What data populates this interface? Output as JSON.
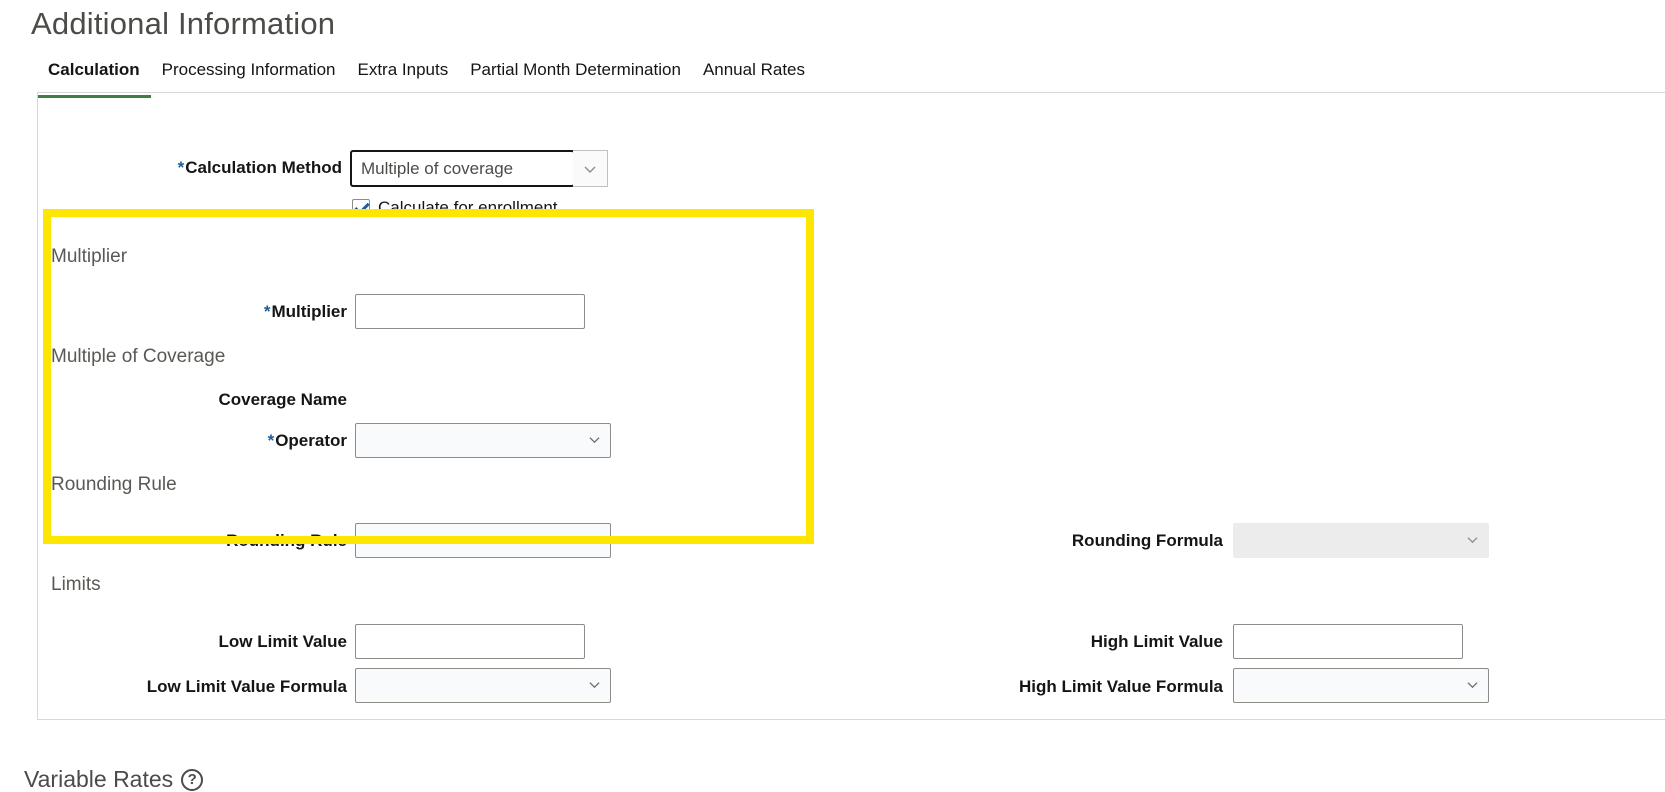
{
  "page": {
    "title": "Additional Information"
  },
  "tabs": [
    {
      "label": "Calculation",
      "active": true
    },
    {
      "label": "Processing Information"
    },
    {
      "label": "Extra Inputs"
    },
    {
      "label": "Partial Month Determination"
    },
    {
      "label": "Annual Rates"
    }
  ],
  "calculation_method": {
    "required_mark": "*",
    "label": "Calculation Method",
    "value": "Multiple of coverage"
  },
  "calculate_for_enrollment": {
    "label": "Calculate for enrollment",
    "checked": true
  },
  "sections": {
    "multiplier": "Multiplier",
    "multiple_of_coverage": "Multiple of Coverage",
    "rounding_rule": "Rounding Rule",
    "limits": "Limits"
  },
  "multiplier": {
    "required_mark": "*",
    "label": "Multiplier",
    "value": ""
  },
  "coverage_name": {
    "label": "Coverage Name"
  },
  "operator": {
    "required_mark": "*",
    "label": "Operator",
    "value": ""
  },
  "rounding_rule": {
    "label": "Rounding Rule",
    "value": ""
  },
  "rounding_formula": {
    "label": "Rounding Formula",
    "value": ""
  },
  "low_limit_value": {
    "label": "Low Limit Value",
    "value": ""
  },
  "high_limit_value": {
    "label": "High Limit Value",
    "value": ""
  },
  "low_limit_value_formula": {
    "label": "Low Limit Value Formula",
    "value": ""
  },
  "high_limit_value_formula": {
    "label": "High Limit Value Formula",
    "value": ""
  },
  "variable_rates": {
    "title": "Variable Rates",
    "help_icon": "?"
  },
  "colors": {
    "tab_underline": "#3f7f3f",
    "required": "#1f5c9c",
    "highlight": "#ffe600"
  }
}
